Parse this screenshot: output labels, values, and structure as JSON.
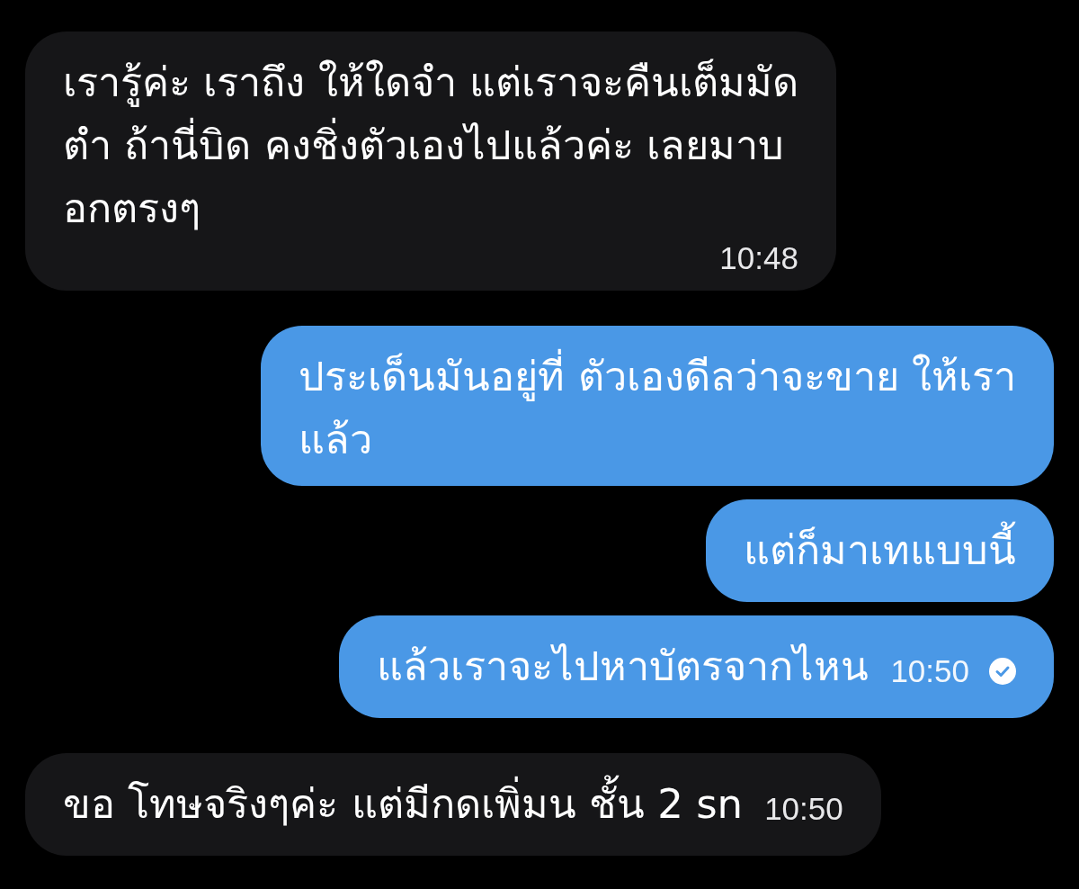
{
  "messages": [
    {
      "kind": "incoming",
      "lines": [
        "เรารู้ค่ะ เราถึง ให้ใดจำ แต่เราจะคืนเต็มมัด",
        "ตำ ถ้านี่บิด คงชิ่งตัวเองไปแล้วค่ะ เลยมาบ",
        "อกตรงๆ"
      ],
      "time": "10:48"
    },
    {
      "kind": "outgoing",
      "lines": [
        "ประเด็นมันอยู่ที่ ตัวเองดีลว่าจะขาย ให้เรา",
        "แล้ว"
      ]
    },
    {
      "kind": "outgoing",
      "lines": [
        "แต่ก็มาเทแบบนี้"
      ]
    },
    {
      "kind": "outgoing",
      "lines": [
        "แล้วเราจะไปหาบัตรจากไหน"
      ],
      "time": "10:50",
      "read": true
    },
    {
      "kind": "incoming",
      "lines": [
        "ขอ โทษจริงๆค่ะ แต่มีกดเพิ่มน ชั้น 2 sn"
      ],
      "time": "10:50"
    }
  ]
}
